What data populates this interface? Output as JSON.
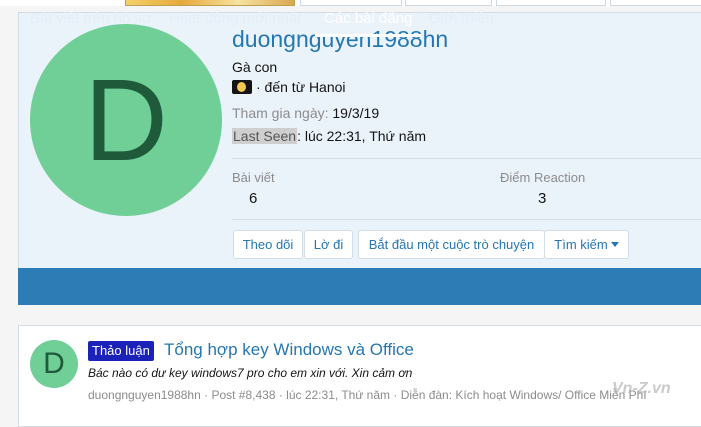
{
  "profile": {
    "avatar_letter": "D",
    "username": "duongnguyen1988hn",
    "user_title": "Gà con",
    "flag_icon": "flag-icon",
    "location_text": "· đến từ Hanoi",
    "joined_label": "Tham gia ngày:",
    "joined_value": "19/3/19",
    "last_seen_label": "Last Seen",
    "last_seen_value": ": lúc 22:31, Thứ năm"
  },
  "stats": [
    {
      "label": "Bài viết",
      "value": "6"
    },
    {
      "label": "Điểm Reaction",
      "value": "3"
    }
  ],
  "actions": {
    "follow": "Theo dõi",
    "ignore": "Lờ đi",
    "start_conversation": "Bắt đầu một cuộc trò chuyện",
    "find": "Tìm kiếm"
  },
  "tabs": [
    {
      "label": "Bài viết trên hồ sơ",
      "active": false
    },
    {
      "label": "Hoạt động mới nhất",
      "active": false
    },
    {
      "label": "Các bài đăng",
      "active": true
    },
    {
      "label": "Giới thiệu",
      "active": false
    }
  ],
  "post": {
    "avatar_letter": "D",
    "prefix": "Thảo luận",
    "title": "Tổng hợp key Windows và Office",
    "snippet": "Bác nào có dư key windows7 pro cho em xin với. Xin cảm ơn",
    "author": "duongnguyen1988hn",
    "meta": " · Post #8,438 · lúc 22:31, Thứ năm · Diễn đàn: ",
    "forum": "Kích hoạt Windows/ Office Miễn Phí"
  },
  "watermark": "Vn-Z.vn",
  "colors": {
    "accent": "#2577b1",
    "tabbar": "#2d7cb5",
    "avatar": "#6fcf97",
    "prefix_badge": "#1a22b8"
  }
}
